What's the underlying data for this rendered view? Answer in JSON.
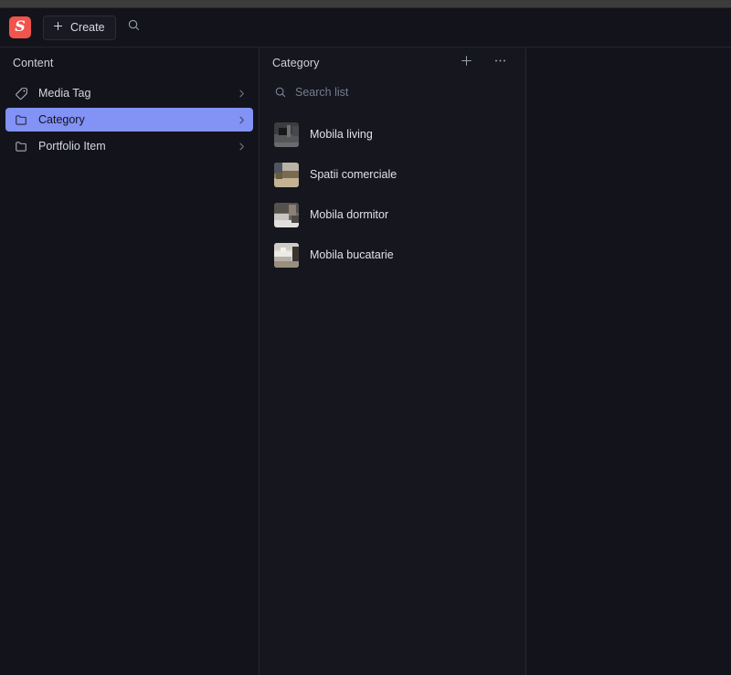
{
  "app": {
    "logo_letter": "S",
    "accent_color": "#f0544c",
    "selected_color": "#8292f5",
    "background_color": "#13141b"
  },
  "navbar": {
    "create_label": "Create",
    "plus_icon": "plus-icon",
    "search_icon": "search-icon"
  },
  "structure_pane": {
    "title": "Content",
    "items": [
      {
        "label": "Media Tag",
        "icon": "tag-icon",
        "selected": false,
        "chevron": "›"
      },
      {
        "label": "Category",
        "icon": "folder-icon",
        "selected": true,
        "chevron": "›"
      },
      {
        "label": "Portfolio Item",
        "icon": "folder-icon",
        "selected": false,
        "chevron": "›"
      }
    ]
  },
  "documents_pane": {
    "title": "Category",
    "add_icon": "plus-icon",
    "menu_icon": "ellipsis-icon",
    "search": {
      "placeholder": "Search list",
      "value": "",
      "icon": "search-icon"
    },
    "items": [
      {
        "title": "Mobila living",
        "thumb": "living-room-dark"
      },
      {
        "title": "Spatii comerciale",
        "thumb": "commercial-space-warm"
      },
      {
        "title": "Mobila dormitor",
        "thumb": "bedroom-light"
      },
      {
        "title": "Mobila bucatarie",
        "thumb": "kitchen-white"
      }
    ]
  }
}
